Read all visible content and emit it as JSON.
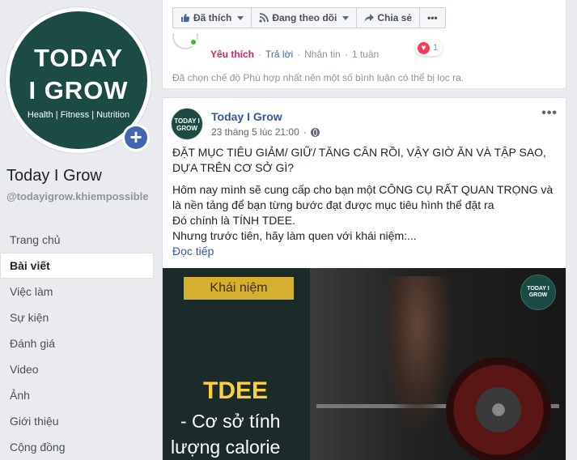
{
  "left": {
    "logo": {
      "line1": "TODAY",
      "line2": "GROW",
      "tagline": "Health | Fitness | Nutrition"
    },
    "add_icon": "+",
    "page_name": "Today I Grow",
    "page_handle": "@todayigrow.khiempossible",
    "nav": [
      {
        "label": "Trang chủ"
      },
      {
        "label": "Bài viết",
        "active": true
      },
      {
        "label": "Việc làm"
      },
      {
        "label": "Sự kiện"
      },
      {
        "label": "Đánh giá"
      },
      {
        "label": "Video"
      },
      {
        "label": "Ảnh"
      },
      {
        "label": "Giới thiệu"
      },
      {
        "label": "Cộng đồng"
      }
    ]
  },
  "top_card": {
    "actions": {
      "like": "Đã thích",
      "follow": "Đang theo dõi",
      "share": "Chia sẻ",
      "more": "•••"
    },
    "comment": {
      "liked_label": "Yêu thích",
      "reply": "Trả lời",
      "message": "Nhắn tin",
      "time": "1 tuần",
      "reaction_count": "1"
    },
    "filter_note": "Đã chọn chế độ Phù hợp nhất nên một số bình luận có thể bị lọc ra."
  },
  "post": {
    "author": "Today I Grow",
    "time": "23 tháng 5 lúc 21:00",
    "dot": "·",
    "more": "•••",
    "avatar_text": "TODAY I GROW",
    "headline": "ĐẶT MỤC TIÊU GIẢM/ GIỮ/ TĂNG CÂN RỒI, VẬY GIỜ ĂN VÀ TẬP SAO, DỰA TRÊN CƠ SỞ GÌ?",
    "line1": "Hôm nay mình sẽ cung cấp cho bạn một CÔNG CỤ RẤT QUAN TRỌNG và là nền tảng để bạn từng bước đạt được mục tiêu hình thể đặt ra",
    "line2": "Đó chính là TÍNH TDEE.",
    "line3": "Nhưng trước tiên, hãy làm quen với khái niệm:...",
    "see_more": "Đọc tiếp",
    "image": {
      "badge": "Khái niệm",
      "title": "TDEE",
      "sub1": "- Cơ sở tính",
      "sub2": "lượng calorie",
      "mini_logo": "TODAY I GROW"
    }
  },
  "colors": {
    "brand_green": "#1c4a44",
    "fb_blue": "#4267b2",
    "link": "#365899",
    "accent_yellow": "#d4b02e"
  },
  "icons": [
    "thumbs-up-icon",
    "rss-icon",
    "share-icon",
    "globe-icon",
    "heart-icon",
    "plus-icon",
    "leaf-icon"
  ]
}
